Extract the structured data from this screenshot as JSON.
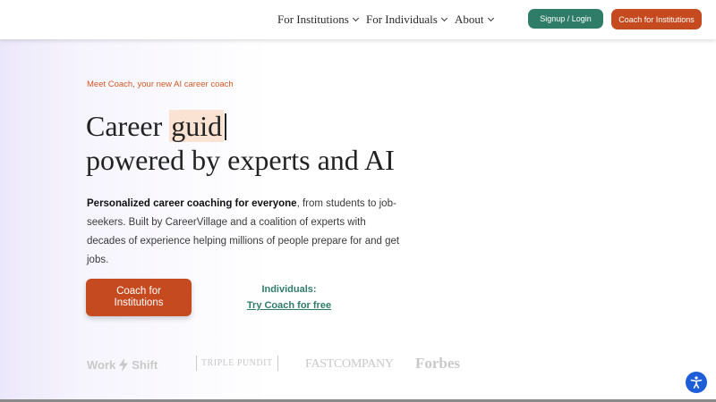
{
  "nav": {
    "items": [
      {
        "label": "For Institutions"
      },
      {
        "label": "For Individuals"
      },
      {
        "label": "About"
      }
    ],
    "signup_label": "Signup / Login",
    "coach_label": "Coach for Institutions"
  },
  "hero": {
    "eyebrow": "Meet Coach, your new AI career coach",
    "headline_prefix": "Career ",
    "headline_typed": "guid",
    "headline_line2": "powered by experts and AI",
    "desc_bold": "Personalized career coaching for everyone",
    "desc_rest": ", from students to job-seekers. Built by CareerVillage and a coalition of experts with decades of experience helping millions of people prepare for and get jobs.",
    "cta_label": "Coach for Institutions",
    "individuals_label": "Individuals:",
    "individuals_link": "Try Coach for free"
  },
  "logos": {
    "workshift_a": "Work",
    "workshift_b": "Shift",
    "triple_pundit": "TRIPLE PUNDIT",
    "fast_company": "FASTCOMPANY",
    "forbes": "Forbes"
  },
  "colors": {
    "brand_orange": "#c54a1f",
    "brand_green": "#2f7d68",
    "accessibility_blue": "#1d5ed8"
  },
  "icons": {
    "chevron": "chevron-down-icon",
    "accessibility": "accessibility-icon",
    "bolt": "bolt-icon"
  }
}
